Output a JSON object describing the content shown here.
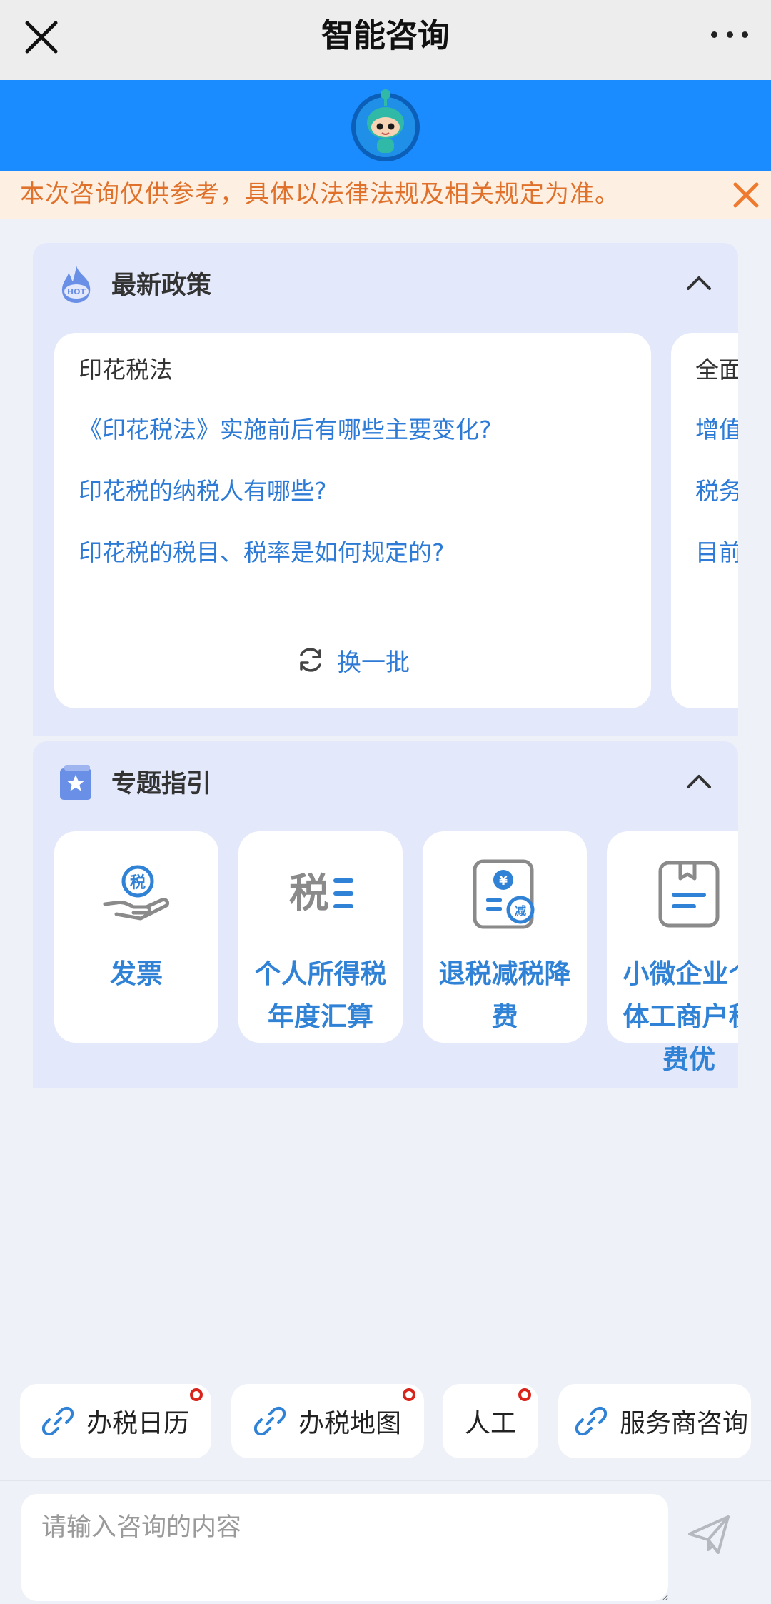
{
  "nav": {
    "title": "智能咨询"
  },
  "notice": {
    "text": "本次咨询仅供参考，具体以法律法规及相关规定为准。"
  },
  "policy": {
    "title": "最新政策",
    "cards": [
      {
        "heading": "印花税法",
        "questions": [
          "《印花税法》实施前后有哪些主要变化?",
          "印花税的纳税人有哪些?",
          "印花税的税目、税率是如何规定的?"
        ],
        "refresh_label": "换一批"
      },
      {
        "heading": "全面",
        "questions": [
          "增值",
          "税务",
          "目前"
        ]
      }
    ]
  },
  "topics": {
    "title": "专题指引",
    "items": [
      {
        "label": "发票",
        "icon": "invoice-hand-icon"
      },
      {
        "label": "个人所得税年度汇算",
        "icon": "tax-document-icon"
      },
      {
        "label": "退税减税降费",
        "icon": "tax-refund-icon"
      },
      {
        "label": "小微企业个体工商户税费优",
        "icon": "folder-doc-icon"
      }
    ]
  },
  "quick_actions": [
    {
      "label": "办税日历",
      "icon": "link-icon",
      "badge": true
    },
    {
      "label": "办税地图",
      "icon": "link-icon",
      "badge": true
    },
    {
      "label": "人工",
      "icon": "",
      "badge": true
    },
    {
      "label": "服务商咨询",
      "icon": "link-icon",
      "badge": false
    }
  ],
  "input": {
    "placeholder": "请输入咨询的内容"
  },
  "colors": {
    "brand_blue": "#1a8cff",
    "link_blue": "#2d7bd6",
    "notice_orange": "#e0712b",
    "badge_red": "#d9241c"
  }
}
